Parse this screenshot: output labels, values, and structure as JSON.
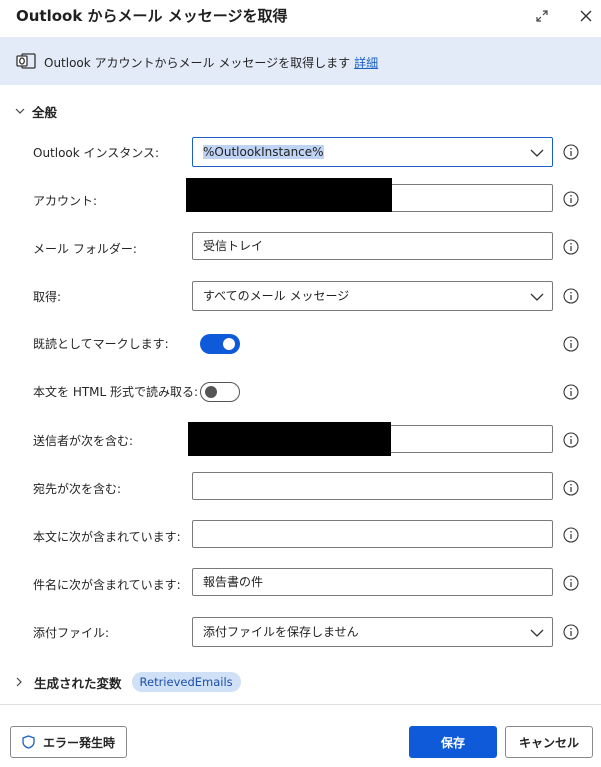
{
  "dialog": {
    "title": "Outlook からメール メッセージを取得",
    "banner_text": "Outlook アカウントからメール メッセージを取得します",
    "banner_link": "詳細"
  },
  "section": {
    "general_label": "全般"
  },
  "fields": {
    "instance": {
      "label": "Outlook インスタンス:",
      "value": "%OutlookInstance%"
    },
    "account": {
      "label": "アカウント:",
      "value": ""
    },
    "folder": {
      "label": "メール フォルダー:",
      "value": "受信トレイ"
    },
    "retrieve": {
      "label": "取得:",
      "value": "すべてのメール メッセージ"
    },
    "mark_read": {
      "label": "既読としてマークします:",
      "state": "on"
    },
    "body_html": {
      "label": "本文を HTML 形式で読み取る:",
      "state": "off"
    },
    "sender": {
      "label": "送信者が次を含む:",
      "value": ""
    },
    "recipient": {
      "label": "宛先が次を含む:",
      "value": ""
    },
    "body_contains": {
      "label": "本文に次が含まれています:",
      "value": ""
    },
    "subject": {
      "label": "件名に次が含まれています:",
      "value": "報告書の件"
    },
    "attachments": {
      "label": "添付ファイル:",
      "value": "添付ファイルを保存しません"
    }
  },
  "variables": {
    "label": "生成された変数",
    "badge": "RetrievedEmails"
  },
  "footer": {
    "error_button": "エラー発生時",
    "save_button": "保存",
    "cancel_button": "キャンセル"
  },
  "colors": {
    "accent": "#0f5ad8",
    "banner_bg": "#e3ebf8",
    "link": "#1c61c6"
  }
}
